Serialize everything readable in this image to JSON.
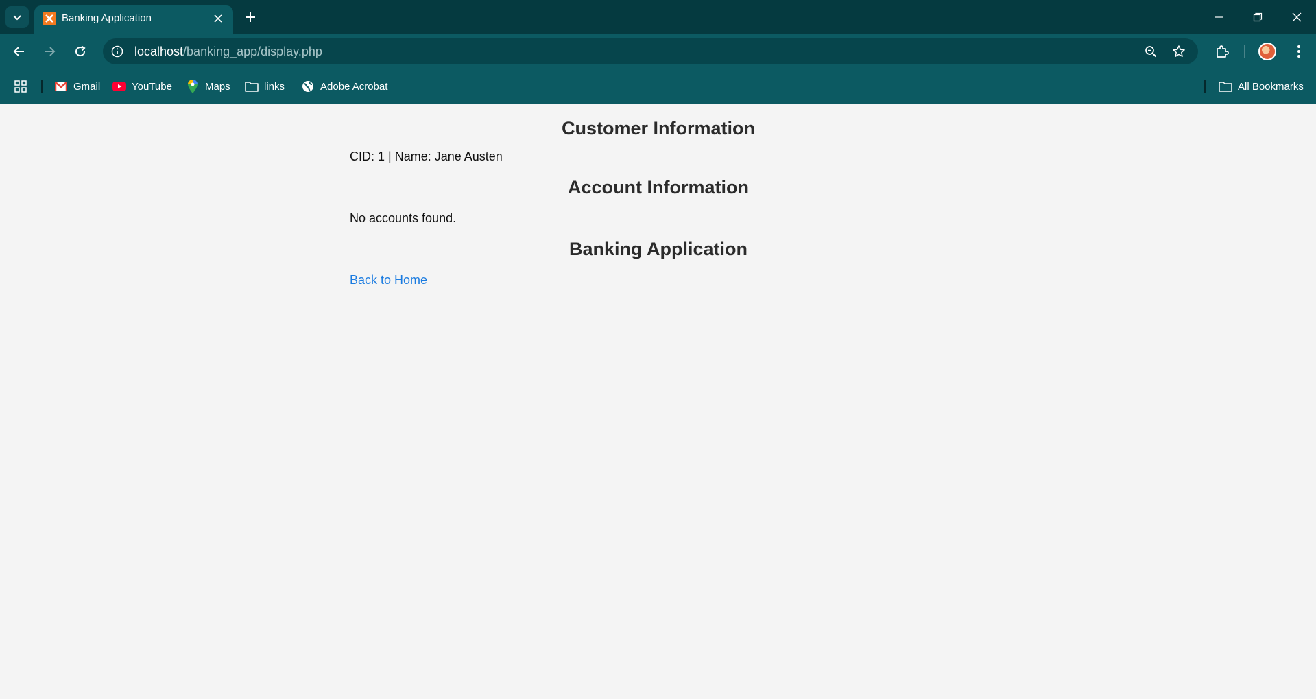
{
  "browser": {
    "tab_title": "Banking Application",
    "url_host": "localhost",
    "url_path": "/banking_app/display.php",
    "bookmarks": [
      {
        "label": "Gmail",
        "icon": "gmail-icon"
      },
      {
        "label": "YouTube",
        "icon": "youtube-icon"
      },
      {
        "label": "Maps",
        "icon": "maps-icon"
      },
      {
        "label": "links",
        "icon": "folder-icon"
      },
      {
        "label": "Adobe Acrobat",
        "icon": "globe-icon"
      }
    ],
    "all_bookmarks": "All Bookmarks",
    "colors": {
      "frame": "#053a40",
      "toolbar": "#0c5a62",
      "omnibox": "#06454c"
    }
  },
  "page": {
    "customer_heading": "Customer Information",
    "customer_line": "CID: 1 | Name: Jane Austen",
    "account_heading": "Account Information",
    "account_line": "No accounts found.",
    "app_heading": "Banking Application",
    "home_link": "Back to Home",
    "colors": {
      "background": "#f4f4f4",
      "heading": "#2b2b2b",
      "link": "#1a7be0"
    }
  }
}
